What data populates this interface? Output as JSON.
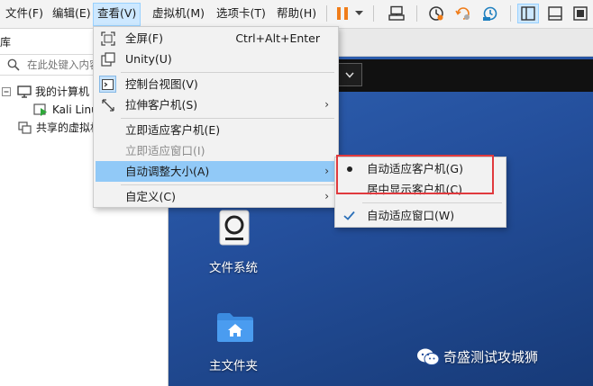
{
  "menubar": {
    "items": [
      {
        "label": "文件(F)"
      },
      {
        "label": "编辑(E)"
      },
      {
        "label": "查看(V)"
      },
      {
        "label": "虚拟机(M)"
      },
      {
        "label": "选项卡(T)"
      },
      {
        "label": "帮助(H)"
      }
    ]
  },
  "library": {
    "title": "库",
    "search_placeholder": "在此处键入内容",
    "tree": [
      {
        "label": "我的计算机"
      },
      {
        "label": "Kali Linux"
      },
      {
        "label": "共享的虚拟机"
      }
    ]
  },
  "view_menu": {
    "items": [
      {
        "label": "全屏(F)",
        "shortcut": "Ctrl+Alt+Enter"
      },
      {
        "label": "Unity(U)"
      },
      {
        "label": "控制台视图(V)"
      },
      {
        "label": "拉伸客户机(S)"
      },
      {
        "label": "立即适应客户机(E)"
      },
      {
        "label": "立即适应窗口(I)"
      },
      {
        "label": "自动调整大小(A)"
      },
      {
        "label": "自定义(C)"
      }
    ]
  },
  "autosize_menu": {
    "items": [
      {
        "label": "自动适应客户机(G)"
      },
      {
        "label": "居中显示客户机(C)"
      },
      {
        "label": "自动适应窗口(W)"
      }
    ]
  },
  "desktop": {
    "icons": [
      {
        "label": "文件系统"
      },
      {
        "label": "主文件夹"
      }
    ],
    "watermark": "奇盛测试攻城狮"
  },
  "colors": {
    "accent_menu_highlight": "#91c9f7",
    "pause_orange": "#f07d1a",
    "annotation_red": "#e03a3e",
    "desktop_blue": "#244f9c"
  }
}
